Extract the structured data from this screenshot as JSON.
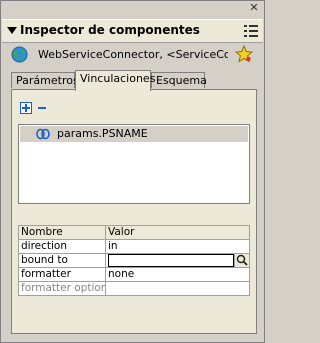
{
  "panel": {
    "title": "Inspector de componentes",
    "component_name": "WebServiceConnector, <ServiceCo..."
  },
  "tabs": [
    {
      "label": "Parámetros"
    },
    {
      "label": "Vinculaciones"
    },
    {
      "label": "Esquema"
    }
  ],
  "bindings": {
    "items": [
      {
        "label": "params.PSNAME"
      }
    ]
  },
  "properties": {
    "headers": {
      "name": "Nombre",
      "value": "Valor"
    },
    "rows": [
      {
        "name": "direction",
        "value": "in"
      },
      {
        "name": "bound to",
        "value": ""
      },
      {
        "name": "formatter",
        "value": "none"
      },
      {
        "name": "formatter options",
        "value": ""
      }
    ]
  },
  "icons": {
    "close": "close-icon",
    "collapse": "triangle-down-icon",
    "options_menu": "options-menu-icon",
    "component": "globe-icon",
    "favorite": "star-icon",
    "add": "plus-icon",
    "remove": "minus-icon",
    "binding": "link-icon",
    "search": "magnifier-icon"
  }
}
